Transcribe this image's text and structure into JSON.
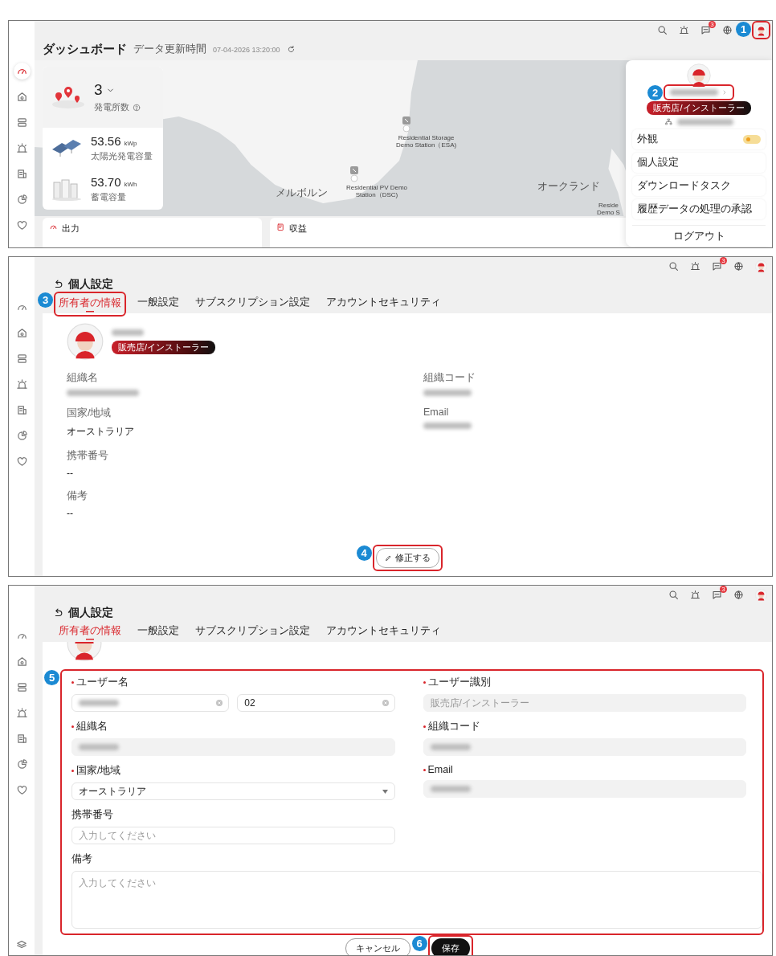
{
  "panels": [
    {
      "kind": "dashboard",
      "topbar": {
        "message_count": "3",
        "avatar_callout": "1"
      },
      "sidebar": [
        {
          "selected": true
        },
        {
          "selected": false
        },
        {
          "selected": false
        },
        {
          "selected": false
        },
        {
          "selected": false
        },
        {
          "selected": false
        },
        {
          "selected": false
        }
      ],
      "title": "ダッシュボード",
      "update_label": "データ更新時間",
      "update_time": "07-04-2026 13:20:00",
      "stats": [
        {
          "kind": "sites",
          "value": "3",
          "label": "発電所数"
        },
        {
          "kind": "solar",
          "value": "53.56",
          "unit": "kWp",
          "label": "太陽光発電容量"
        },
        {
          "kind": "storage",
          "value": "53.70",
          "unit": "kWh",
          "label": "蓄電容量"
        }
      ],
      "map_labels": [
        {
          "kind": "station",
          "text": "Residential Storage\nDemo Station（ESA)"
        },
        {
          "kind": "city",
          "text": "メルボルン"
        },
        {
          "kind": "station",
          "text": "Residential PV Demo\nStation（DSC)"
        },
        {
          "kind": "city",
          "text": "オークランド"
        },
        {
          "kind": "station",
          "text": "Reside\nDemo S"
        }
      ],
      "cards": [
        {
          "kind": "output",
          "title": "出力"
        },
        {
          "kind": "revenue",
          "title": "収益"
        }
      ],
      "menu": {
        "name_callout": "2",
        "role": "販売店/インストーラー",
        "items": [
          {
            "kind": "toggle",
            "label": "外観",
            "on": false
          },
          {
            "kind": "link",
            "label": "個人設定"
          },
          {
            "kind": "link",
            "label": "ダウンロードタスク"
          },
          {
            "kind": "link",
            "label": "履歴データの処理の承認"
          },
          {
            "kind": "logout",
            "label": "ログアウト"
          }
        ]
      }
    },
    {
      "kind": "profile",
      "topbar": {
        "message_count": "3"
      },
      "sidebar": [
        {
          "selected": false
        },
        {
          "selected": false
        },
        {
          "selected": false
        },
        {
          "selected": false
        },
        {
          "selected": false
        },
        {
          "selected": false
        },
        {
          "selected": false
        }
      ],
      "title": "個人設定",
      "tabs": [
        {
          "label": "所有者の情報",
          "selected": true,
          "callout": "3"
        },
        {
          "label": "一般設定",
          "selected": false
        },
        {
          "label": "サブスクリプション設定",
          "selected": false
        },
        {
          "label": "アカウントセキュリティ",
          "selected": false
        }
      ],
      "role": "販売店/インストーラー",
      "rows": [
        [
          {
            "label": "組織名",
            "kind": "blurred"
          },
          {
            "label": "組織コード",
            "kind": "blurred"
          }
        ],
        [
          {
            "label": "国家/地域",
            "kind": "text",
            "value": "オーストラリア"
          },
          {
            "label": "Email",
            "kind": "blurred"
          }
        ],
        [
          {
            "label": "携帯番号",
            "kind": "text",
            "value": "--"
          }
        ],
        [
          {
            "label": "備考",
            "kind": "text",
            "value": "--"
          }
        ]
      ],
      "edit_button": {
        "label": "修正する",
        "callout": "4"
      }
    },
    {
      "kind": "edit",
      "topbar": {
        "message_count": "3"
      },
      "sidebar": [
        {
          "selected": false
        },
        {
          "selected": false
        },
        {
          "selected": false
        },
        {
          "selected": false
        },
        {
          "selected": false
        },
        {
          "selected": false
        },
        {
          "selected": false
        }
      ],
      "sidebar_footer_icon": true,
      "title": "個人設定",
      "tabs": [
        {
          "label": "所有者の情報",
          "selected": true
        },
        {
          "label": "一般設定",
          "selected": false
        },
        {
          "label": "サブスクリプション設定",
          "selected": false
        },
        {
          "label": "アカウントセキュリティ",
          "selected": false
        }
      ],
      "form_callout": "5",
      "rows": [
        [
          {
            "label": "ユーザー名",
            "required": true,
            "inputs": [
              {
                "kind": "blurred",
                "disabled": false,
                "clearable": true
              },
              {
                "kind": "text",
                "value": "02",
                "disabled": false,
                "clearable": true
              }
            ]
          },
          {
            "label": "ユーザー識別",
            "required": true,
            "inputs": [
              {
                "kind": "text",
                "value": "販売店/インストーラー",
                "disabled": true,
                "clearable": false
              }
            ]
          }
        ],
        [
          {
            "label": "組織名",
            "required": true,
            "inputs": [
              {
                "kind": "blurred",
                "disabled": true,
                "clearable": false
              }
            ]
          },
          {
            "label": "組織コード",
            "required": true,
            "inputs": [
              {
                "kind": "blurred",
                "disabled": true,
                "clearable": false
              }
            ]
          }
        ],
        [
          {
            "label": "国家/地域",
            "required": true,
            "inputs": [
              {
                "kind": "select",
                "value": "オーストラリア",
                "disabled": false,
                "clearable": false
              }
            ]
          },
          {
            "label": "Email",
            "required": true,
            "inputs": [
              {
                "kind": "blurred",
                "disabled": true,
                "clearable": false
              }
            ]
          }
        ],
        [
          {
            "label": "携帯番号",
            "required": false,
            "inputs": [
              {
                "kind": "text",
                "placeholder": "入力してください",
                "disabled": false,
                "clearable": false
              }
            ]
          }
        ],
        [
          {
            "label": "備考",
            "required": false,
            "inputs": [
              {
                "kind": "textarea",
                "placeholder": "入力してください",
                "disabled": false,
                "clearable": false
              }
            ]
          }
        ]
      ],
      "buttons": [
        {
          "kind": "secondary",
          "label": "キャンセル"
        },
        {
          "kind": "primary",
          "label": "保存",
          "callout": "6"
        }
      ]
    }
  ]
}
